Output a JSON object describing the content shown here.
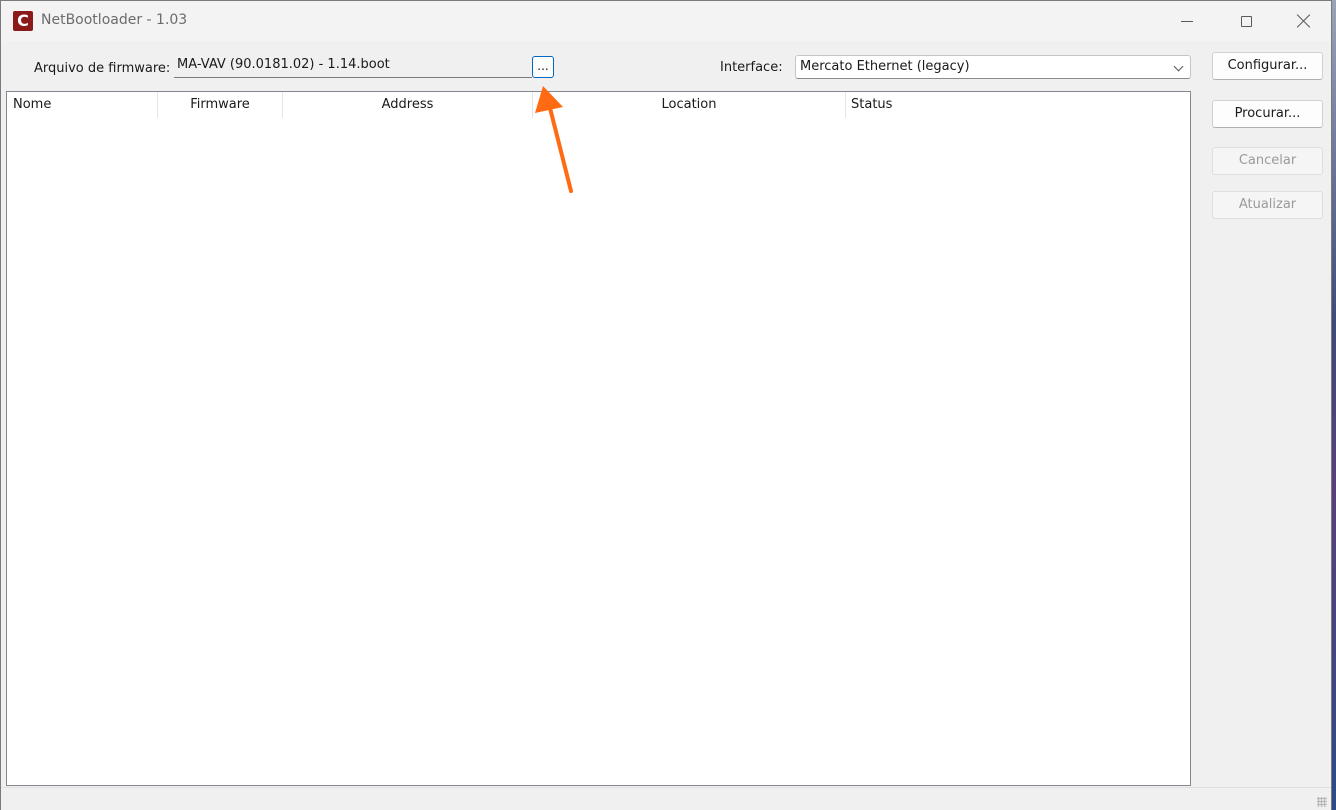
{
  "window": {
    "title": "NetBootloader - 1.03",
    "icon": "app-logo-icon",
    "icon_letter": "C"
  },
  "toolbar": {
    "firmware_label": "Arquivo de firmware:",
    "firmware_value": "MA-VAV (90.0181.02) - 1.14.boot",
    "browse_label": "...",
    "interface_label": "Interface:",
    "interface_value": "Mercato Ethernet (legacy)"
  },
  "sidebar": {
    "configurar": "Configurar...",
    "procurar": "Procurar...",
    "cancelar": "Cancelar",
    "atualizar": "Atualizar"
  },
  "table": {
    "columns": [
      "Nome",
      "Firmware",
      "Address",
      "Location",
      "Status"
    ],
    "rows": []
  },
  "annotation": {
    "type": "arrow",
    "color": "#ff6a13",
    "points_to": "browse-button"
  },
  "colors": {
    "accent": "#0067c0",
    "app_icon_bg": "#8b1a1a",
    "disabled_text": "#9a9a9a"
  }
}
